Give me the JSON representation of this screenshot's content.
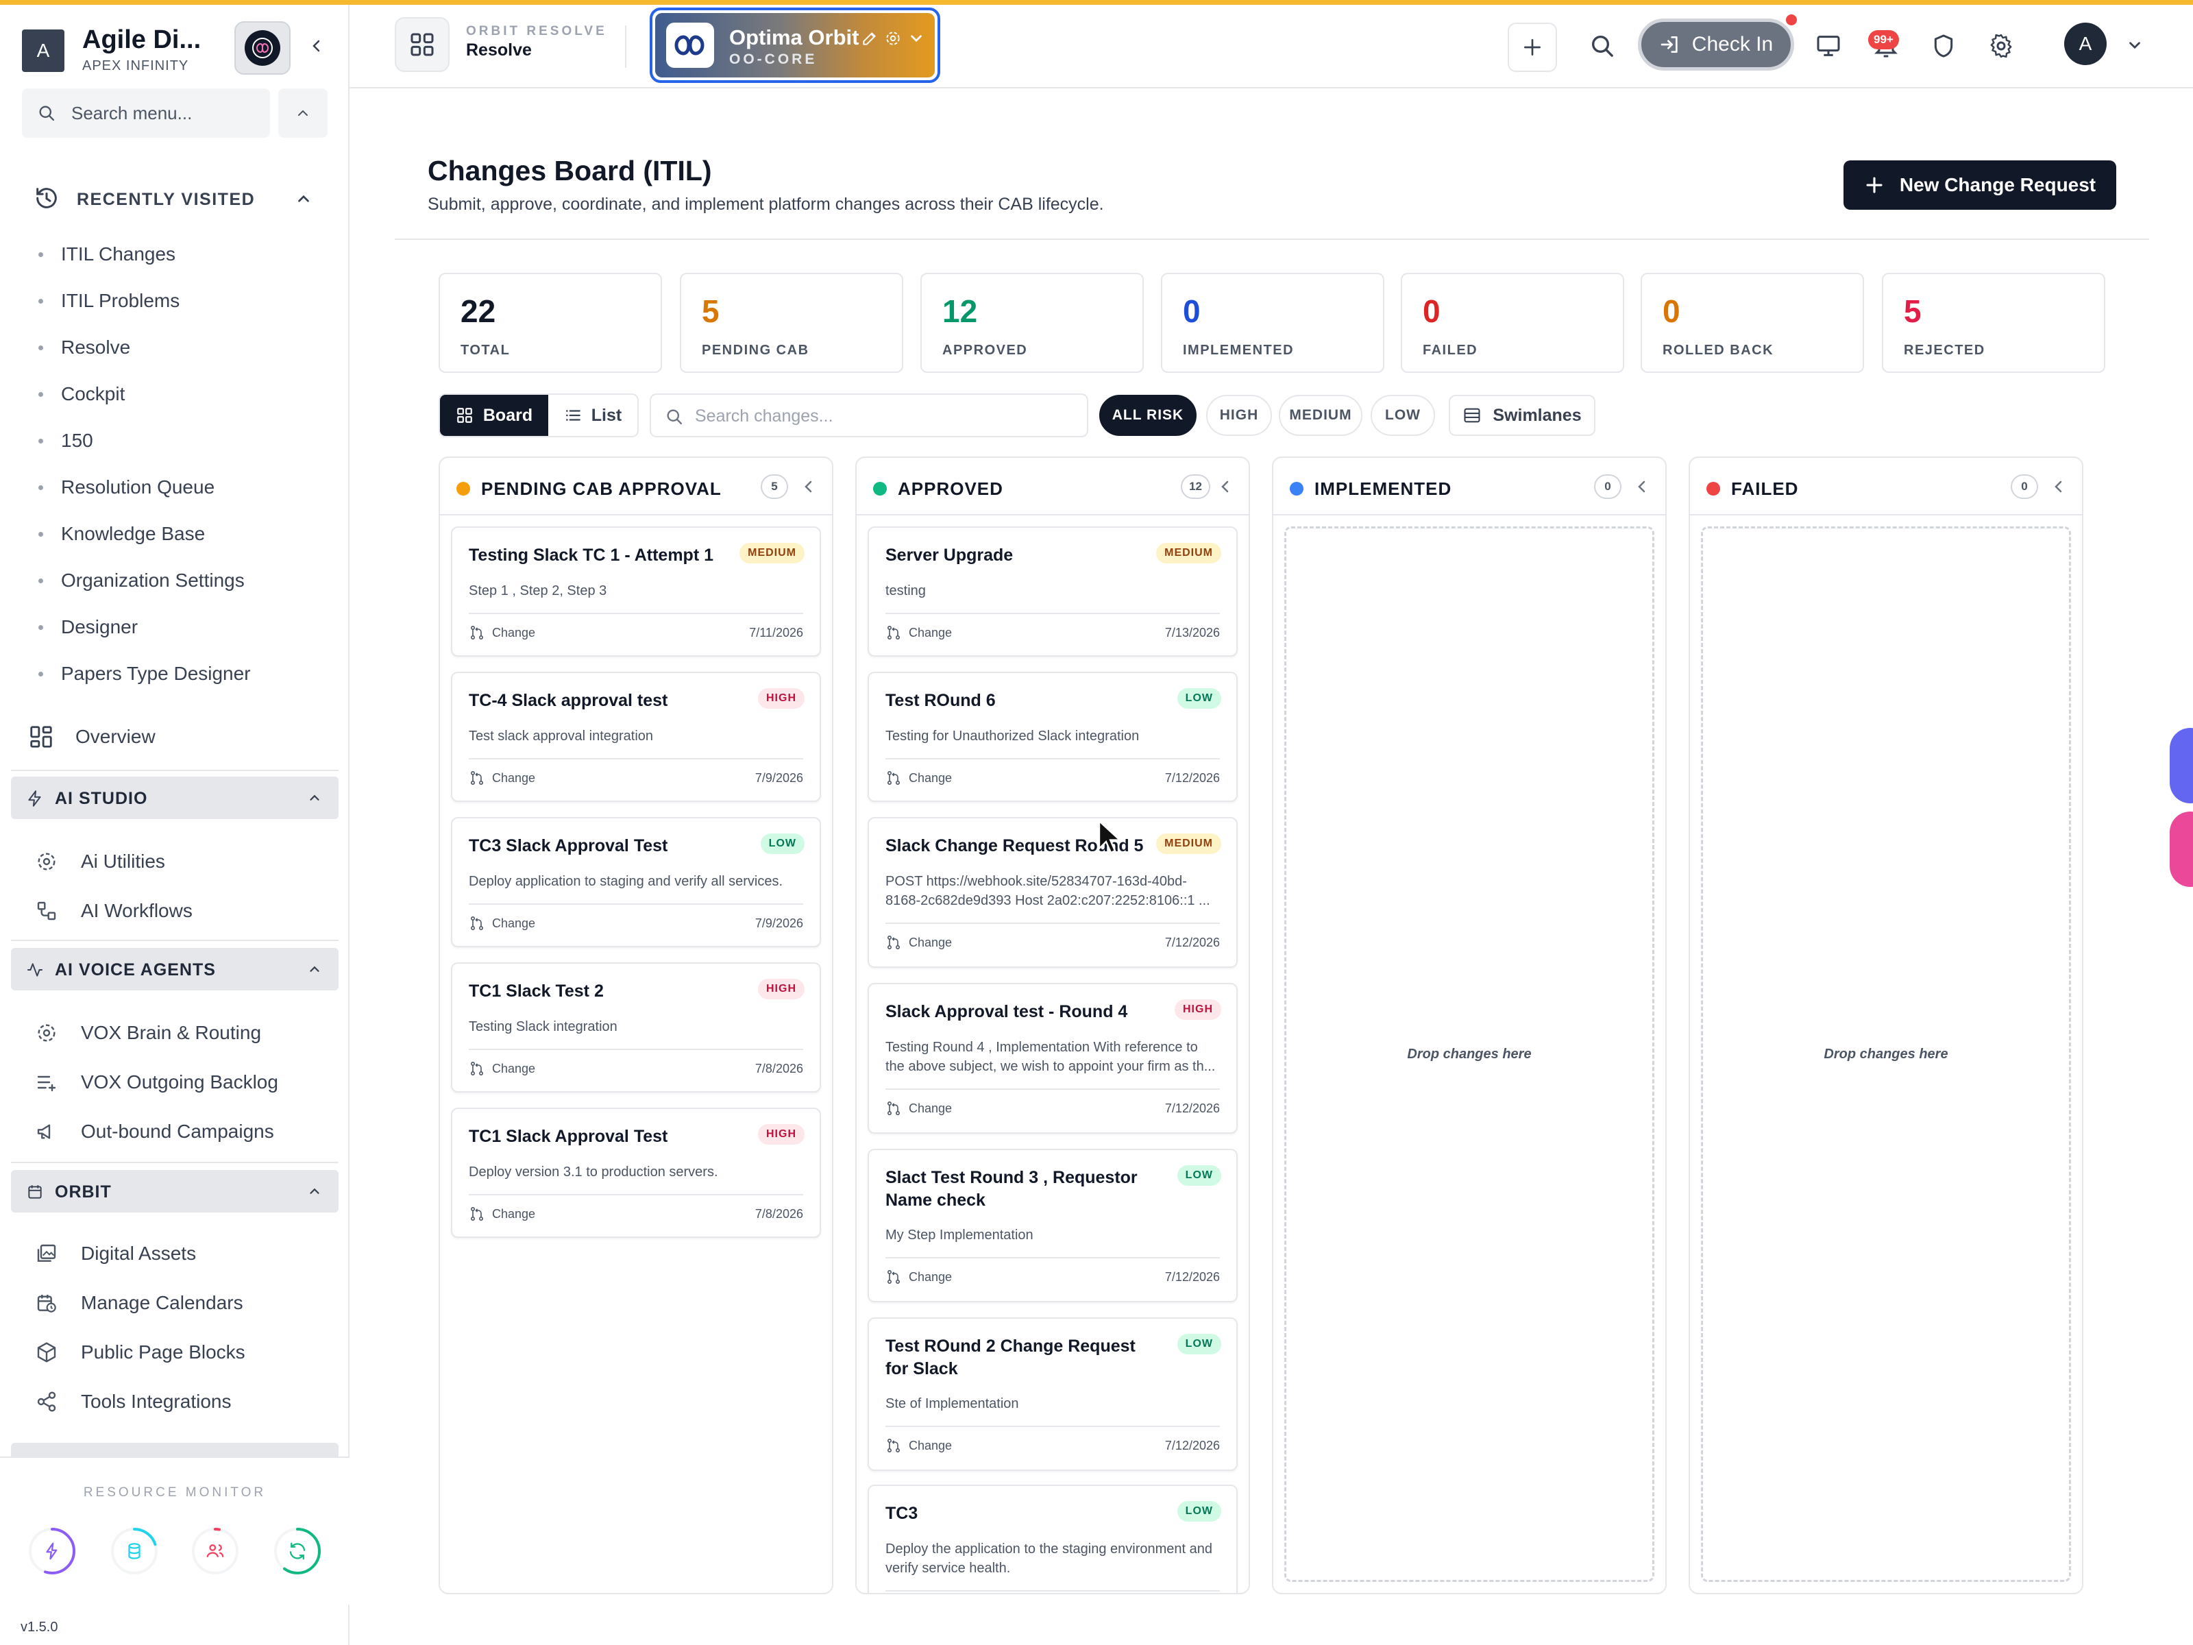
{
  "sidebar": {
    "logo_letter": "A",
    "app_title": "Agile Di...",
    "app_subtitle": "APEX INFINITY",
    "search_placeholder": "Search menu...",
    "recent_label": "RECENTLY VISITED",
    "recent_items": [
      "ITIL Changes",
      "ITIL Problems",
      "Resolve",
      "Cockpit",
      "150",
      "Resolution Queue",
      "Knowledge Base",
      "Organization Settings",
      "Designer",
      "Papers Type Designer"
    ],
    "overview_label": "Overview",
    "groups": [
      {
        "label": "AI STUDIO",
        "items": [
          "Ai Utilities",
          "AI Workflows"
        ]
      },
      {
        "label": "AI VOICE AGENTS",
        "items": [
          "VOX Brain & Routing",
          "VOX Outgoing Backlog",
          "Out-bound Campaigns"
        ]
      },
      {
        "label": "ORBIT",
        "items": [
          "Digital Assets",
          "Manage Calendars",
          "Public Page Blocks",
          "Tools Integrations"
        ]
      }
    ],
    "resource_monitor_label": "RESOURCE MONITOR",
    "gauges": [
      {
        "icon": "bolt-icon",
        "color": "#8b5cf6",
        "level": 0.55
      },
      {
        "icon": "database-icon",
        "color": "#22d3ee",
        "level": 0.2
      },
      {
        "icon": "users-icon",
        "color": "#f43f5e",
        "level": 0.03
      },
      {
        "icon": "refresh-icon",
        "color": "#10b981",
        "level": 0.6
      }
    ],
    "version": "v1.5.0"
  },
  "topbar": {
    "module_sub": "ORBIT RESOLVE",
    "module_title": "Resolve",
    "workspace_name": "Optima Orbit",
    "workspace_code": "OO-CORE",
    "checkin_label": "Check In",
    "notif_badge": "99+",
    "avatar_letter": "A"
  },
  "page": {
    "title": "Changes Board (ITIL)",
    "subtitle": "Submit, approve, coordinate, and implement platform changes across their CAB lifecycle.",
    "new_button": "New Change Request"
  },
  "stats": [
    {
      "value": "22",
      "label": "TOTAL",
      "color": "#111827"
    },
    {
      "value": "5",
      "label": "PENDING CAB",
      "color": "#d97706"
    },
    {
      "value": "12",
      "label": "APPROVED",
      "color": "#059669"
    },
    {
      "value": "0",
      "label": "IMPLEMENTED",
      "color": "#1d4ed8"
    },
    {
      "value": "0",
      "label": "FAILED",
      "color": "#dc2626"
    },
    {
      "value": "0",
      "label": "ROLLED BACK",
      "color": "#d97706"
    },
    {
      "value": "5",
      "label": "REJECTED",
      "color": "#e11d48"
    }
  ],
  "toolbar": {
    "board_label": "Board",
    "list_label": "List",
    "search_placeholder": "Search changes...",
    "risk_filters": [
      "ALL RISK",
      "HIGH",
      "MEDIUM",
      "LOW"
    ],
    "swimlanes_label": "Swimlanes"
  },
  "columns": [
    {
      "title": "PENDING CAB APPROVAL",
      "count": "5",
      "color": "#f59e0b",
      "cards": [
        {
          "title": "Testing Slack TC 1 - Attempt 1",
          "risk": "MEDIUM",
          "desc": "Step 1 , Step 2, Step 3",
          "type": "Change",
          "date": "7/11/2026"
        },
        {
          "title": "TC-4 Slack approval test",
          "risk": "HIGH",
          "desc": "Test slack approval integration",
          "type": "Change",
          "date": "7/9/2026"
        },
        {
          "title": "TC3 Slack Approval Test",
          "risk": "LOW",
          "desc": "Deploy application to staging and verify all services.",
          "type": "Change",
          "date": "7/9/2026"
        },
        {
          "title": "TC1 Slack Test 2",
          "risk": "HIGH",
          "desc": "Testing Slack integration",
          "type": "Change",
          "date": "7/8/2026"
        },
        {
          "title": "TC1 Slack Approval Test",
          "risk": "HIGH",
          "desc": "Deploy version 3.1 to production servers.",
          "type": "Change",
          "date": "7/8/2026"
        }
      ]
    },
    {
      "title": "APPROVED",
      "count": "12",
      "color": "#10b981",
      "cards": [
        {
          "title": "Server Upgrade",
          "risk": "MEDIUM",
          "desc": "testing",
          "type": "Change",
          "date": "7/13/2026"
        },
        {
          "title": "Test ROund 6",
          "risk": "LOW",
          "desc": "Testing for Unauthorized Slack integration",
          "type": "Change",
          "date": "7/12/2026"
        },
        {
          "title": "Slack Change Request Round 5",
          "risk": "MEDIUM",
          "desc": "POST https://webhook.site/52834707-163d-40bd-8168-2c682de9d393 Host 2a02:c207:2252:8106::1 ...",
          "type": "Change",
          "date": "7/12/2026"
        },
        {
          "title": "Slack Approval test - Round 4",
          "risk": "HIGH",
          "desc": "Testing Round 4 , Implementation With reference to the above subject, we wish to appoint your firm as th...",
          "type": "Change",
          "date": "7/12/2026"
        },
        {
          "title": "Slact Test Round 3 , Requestor Name check",
          "risk": "LOW",
          "desc": "My Step Implementation",
          "type": "Change",
          "date": "7/12/2026"
        },
        {
          "title": "Test ROund 2 Change Request for Slack",
          "risk": "LOW",
          "desc": "Ste of Implementation",
          "type": "Change",
          "date": "7/12/2026"
        },
        {
          "title": "TC3",
          "risk": "LOW",
          "desc": "Deploy the application to the staging environment and verify service health.",
          "type": "Change",
          "date": ""
        }
      ]
    },
    {
      "title": "IMPLEMENTED",
      "count": "0",
      "color": "#3b82f6",
      "cards": [],
      "empty": "Drop changes here"
    },
    {
      "title": "FAILED",
      "count": "0",
      "color": "#ef4444",
      "cards": [],
      "empty": "Drop changes here"
    }
  ]
}
